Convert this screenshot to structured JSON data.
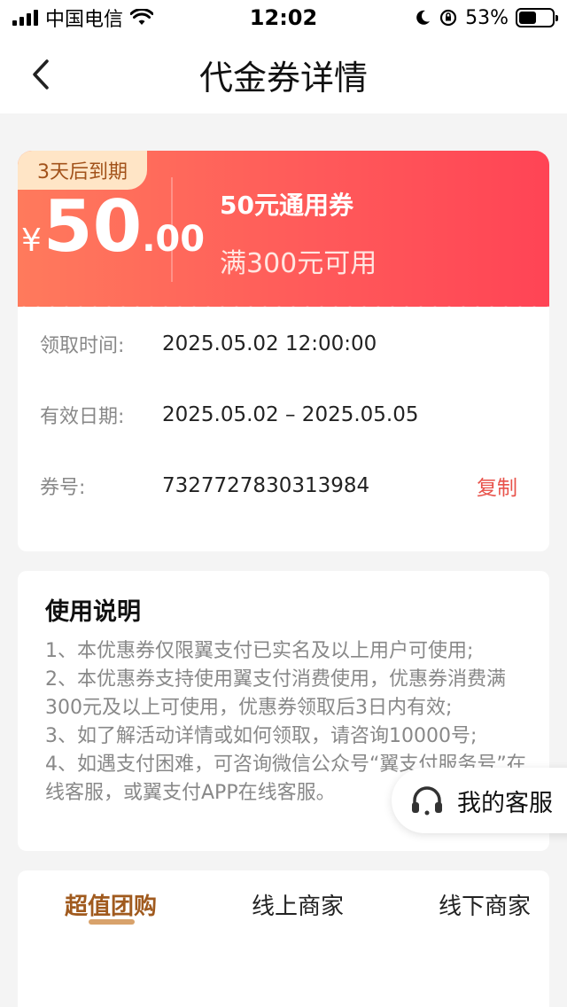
{
  "status_bar": {
    "carrier": "中国电信",
    "time": "12:02",
    "battery": "53%",
    "battery_level": 0.53
  },
  "nav": {
    "title": "代金券详情",
    "back_icon": "chevron-left-icon"
  },
  "coupon": {
    "badge": "3天后到期",
    "currency": "¥",
    "amount_int": "50",
    "amount_dec": ".00",
    "name": "50元通用券",
    "condition": "满300元可用",
    "colors": {
      "start": "#ff7a5c",
      "end": "#ff4455",
      "badge_bg": "#ffe5c6"
    }
  },
  "details": {
    "received_label": "领取时间:",
    "received_value": "2025.05.02 12:00:00",
    "valid_label": "有效日期:",
    "valid_value": "2025.05.02 – 2025.05.05",
    "code_label": "券号:",
    "code_value": "7327727830313984",
    "copy_label": "复制"
  },
  "instructions": {
    "title": "使用说明",
    "lines": [
      "1、本优惠券仅限翼支付已实名及以上用户可使用;",
      "2、本优惠券支持使用翼支付消费使用，优惠券消费满300元及以上可使用，优惠券领取后3日内有效;",
      "3、如了解活动详情或如何领取，请咨询10000号;",
      "4、如遇支付困难，可咨询微信公众号“翼支付服务号”在线客服，或翼支付APP在线客服。"
    ]
  },
  "customer_service": {
    "label": "我的客服",
    "icon": "headset-icon"
  },
  "tabs": [
    {
      "label": "超值团购",
      "active": true
    },
    {
      "label": "线上商家",
      "active": false
    },
    {
      "label": "线下商家",
      "active": false
    }
  ]
}
